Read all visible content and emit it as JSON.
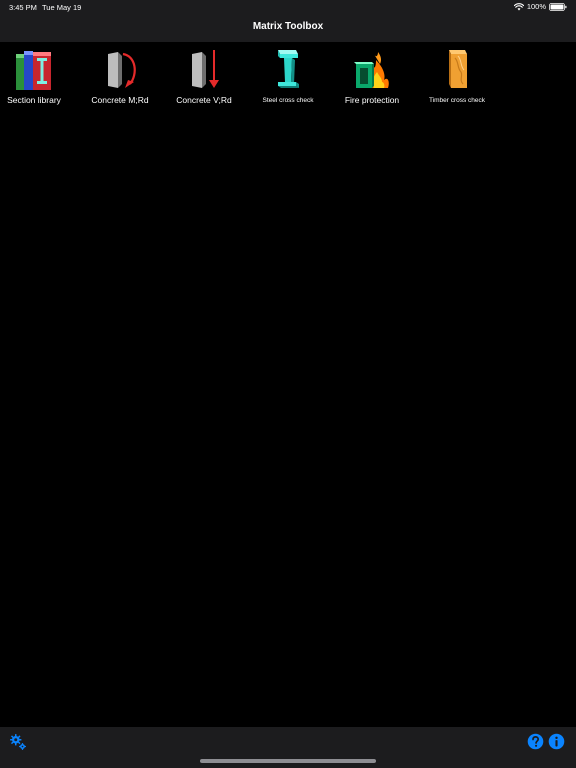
{
  "status_bar": {
    "time": "3:45 PM",
    "date": "Tue May 19",
    "battery": "100%"
  },
  "nav": {
    "title": "Matrix Toolbox"
  },
  "tools": [
    {
      "label": "Section library",
      "icon": "books-icon"
    },
    {
      "label": "Concrete M;Rd",
      "icon": "concrete-moment-icon"
    },
    {
      "label": "Concrete V;Rd",
      "icon": "concrete-shear-icon"
    },
    {
      "label": "Steel cross check",
      "icon": "steel-beam-icon"
    },
    {
      "label": "Fire protection",
      "icon": "fire-icon"
    },
    {
      "label": "Timber cross check",
      "icon": "timber-block-icon"
    }
  ],
  "colors": {
    "accent": "#0a84ff",
    "bar_background": "#1c1c1e",
    "background": "#000000"
  }
}
